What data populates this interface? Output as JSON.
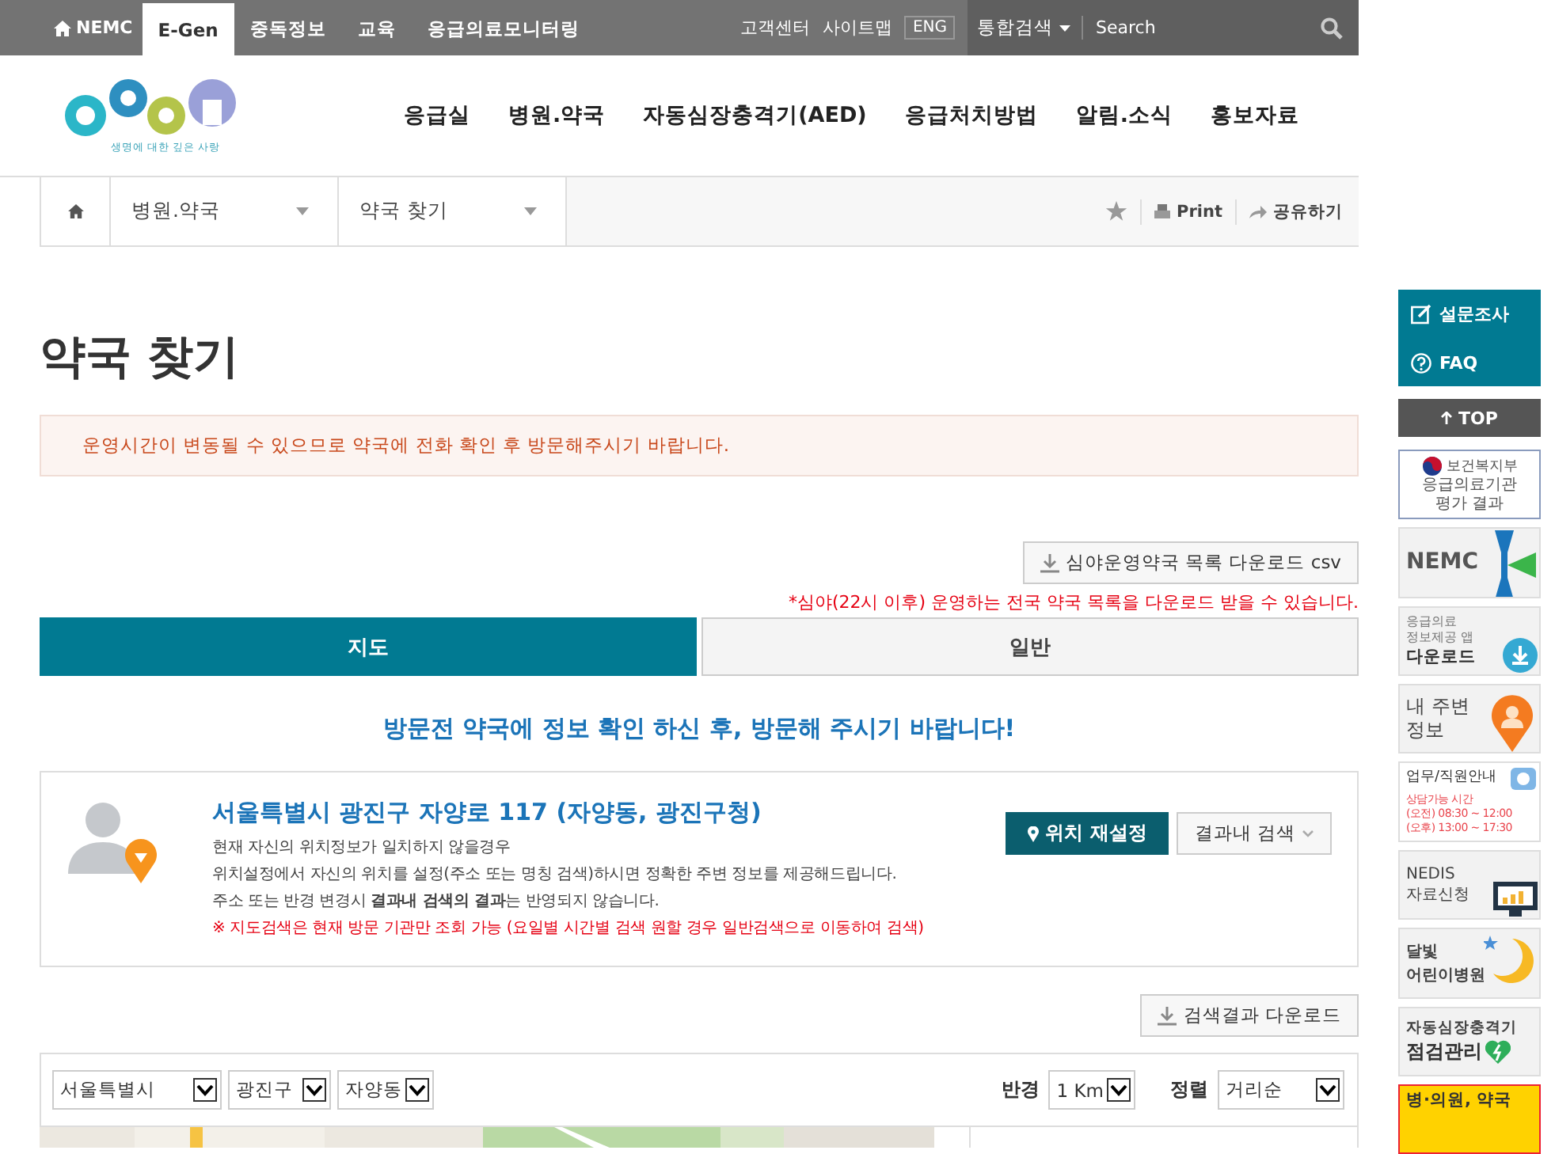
{
  "top_bar": {
    "home_label": "NEMC",
    "tabs": [
      {
        "label": "E-Gen",
        "selected": true
      },
      {
        "label": "중독정보",
        "selected": false
      },
      {
        "label": "교육",
        "selected": false
      },
      {
        "label": "응급의료모니터링",
        "selected": false
      }
    ],
    "links": [
      "고객센터",
      "사이트맵"
    ],
    "lang": "ENG",
    "search": {
      "scope": "통합검색",
      "placeholder": "Search"
    }
  },
  "header": {
    "logo_tagline": "생명에 대한 깊은 사랑",
    "nav": [
      "응급실",
      "병원.약국",
      "자동심장충격기(AED)",
      "응급처치방법",
      "알림.소식",
      "홍보자료"
    ]
  },
  "breadcrumb": {
    "items": [
      "병원.약국",
      "약국 찾기"
    ],
    "print": "Print",
    "share": "공유하기"
  },
  "page_title": "약국 찾기",
  "notice": "운영시간이 변동될 수 있으므로 약국에 전화 확인 후 방문해주시기 바랍니다.",
  "csv_button": "심야운영약국 목록 다운로드 csv",
  "csv_note": "*심야(22시 이후) 운영하는 전국 약국 목록을 다운로드 받을 수 있습니다.",
  "view_tabs": [
    {
      "label": "지도",
      "selected": true
    },
    {
      "label": "일반",
      "selected": false
    }
  ],
  "visit_message": "방문전 약국에 정보 확인 하신 후, 방문해 주시기 바랍니다!",
  "location": {
    "address": "서울특별시 광진구 자양로 117 (자양동, 광진구청)",
    "lines": [
      {
        "kind": "info",
        "text": "현재 자신의 위치정보가 일치하지 않을경우"
      },
      {
        "kind": "info",
        "text": "위치설정에서 자신의 위치를 설정(주소 또는 명칭 검색)하시면 정확한 주변 정보를 제공해드립니다."
      },
      {
        "kind": "info",
        "text": "주소 또는 반경 변경시 **결과내 검색의 결과**는 반영되지 않습니다."
      },
      {
        "kind": "warning",
        "text": "※ 지도검색은 현재 방문 기관만 조회 가능 (요일별 시간별 검색 원할 경우 일반검색으로 이동하여 검색)"
      }
    ],
    "reset_button": "위치 재설정",
    "filter_button": "결과내 검색"
  },
  "download_button": "검색결과 다운로드",
  "filters": {
    "regions": [
      "서울특별시",
      "광진구",
      "자양동"
    ],
    "radius": {
      "label": "반경",
      "value": "1 Km"
    },
    "sort": {
      "label": "정렬",
      "value": "거리순"
    }
  },
  "sidebar": {
    "survey": "설문조사",
    "faq": "FAQ",
    "top": "TOP",
    "banners": [
      {
        "kind": "mohw",
        "lines": [
          "보건복지부",
          "응급의료기관",
          "평가 결과"
        ]
      },
      {
        "kind": "nemc",
        "lines": [
          "NEMC"
        ]
      },
      {
        "kind": "app",
        "lines": [
          "응급의료",
          "정보제공 앱",
          "다운로드"
        ]
      },
      {
        "kind": "nearby",
        "lines": [
          "내 주변",
          "정보"
        ]
      },
      {
        "kind": "staff",
        "lines": [
          "업무/직원안내",
          "상담가능 시간",
          "(오전) 08:30 ~ 12:00",
          "(오후) 13:00 ~ 17:30"
        ]
      },
      {
        "kind": "nedis",
        "lines": [
          "NEDIS",
          "자료신청"
        ]
      },
      {
        "kind": "moon",
        "lines": [
          "달빛",
          "어린이병원"
        ]
      },
      {
        "kind": "aed",
        "lines": [
          "자동심장충격기",
          "점검관리"
        ]
      },
      {
        "kind": "clinic",
        "lines": [
          "병·의원, 약국"
        ]
      }
    ]
  }
}
